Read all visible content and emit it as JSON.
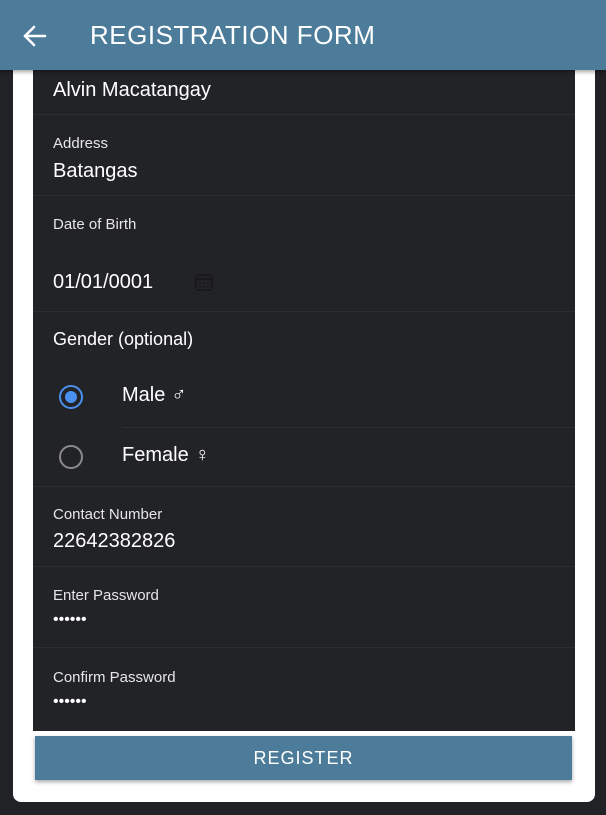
{
  "app_bar": {
    "title": "REGISTRATION FORM",
    "back_icon": "arrow-left-icon"
  },
  "form": {
    "name": {
      "value": "Alvin Macatangay"
    },
    "address": {
      "label": "Address",
      "value": "Batangas"
    },
    "date_of_birth": {
      "label": "Date of Birth",
      "value": "01/01/0001",
      "icon": "calendar-icon"
    },
    "gender": {
      "label": "Gender (optional)",
      "options": [
        {
          "label": "Male",
          "symbol": "♂",
          "selected": true
        },
        {
          "label": "Female",
          "symbol": "♀",
          "selected": false
        }
      ]
    },
    "contact_number": {
      "label": "Contact Number",
      "value": "22642382826"
    },
    "password": {
      "label": "Enter Password",
      "value": "••••••"
    },
    "confirm_password": {
      "label": "Confirm Password",
      "value": "••••••"
    }
  },
  "register_button": {
    "label": "REGISTER"
  },
  "colors": {
    "app_bar": "#4d7c9b",
    "background": "#212226",
    "form_panel": "#222327",
    "radio_selected": "#4a90f0"
  }
}
